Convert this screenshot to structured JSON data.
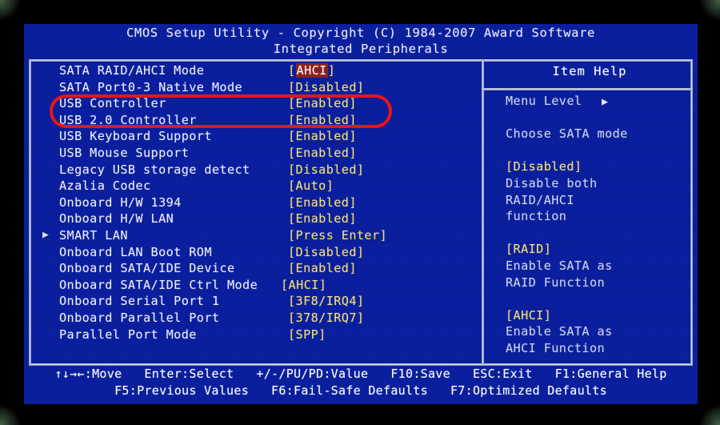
{
  "header": {
    "line1": "CMOS Setup Utility - Copyright (C) 1984-2007 Award Software",
    "line2": "Integrated Peripherals"
  },
  "settings": {
    "rows": [
      {
        "marker": "",
        "label": "SATA RAID/AHCI Mode",
        "value_prefix": "[",
        "value_hl": "AHCI",
        "value_suffix": "]",
        "highlighted": true
      },
      {
        "marker": "",
        "label": "SATA Port0-3 Native Mode",
        "value": "[Disabled]"
      },
      {
        "marker": "",
        "label": "USB Controller",
        "value": "[Enabled]"
      },
      {
        "marker": "",
        "label": "USB 2.0 Controller",
        "value": "[Enabled]"
      },
      {
        "marker": "",
        "label": "USB Keyboard Support",
        "value": "[Enabled]"
      },
      {
        "marker": "",
        "label": "USB Mouse Support",
        "value": "[Enabled]"
      },
      {
        "marker": "",
        "label": "Legacy USB storage detect",
        "value": "[Disabled]"
      },
      {
        "marker": "",
        "label": "Azalia Codec",
        "value": "[Auto]"
      },
      {
        "marker": "",
        "label": "Onboard H/W 1394",
        "value": "[Enabled]"
      },
      {
        "marker": "",
        "label": "Onboard H/W LAN",
        "value": "[Enabled]"
      },
      {
        "marker": "▶",
        "label": "SMART LAN",
        "value": "[Press Enter]"
      },
      {
        "marker": "",
        "label": "Onboard LAN Boot ROM",
        "value": "[Disabled]"
      },
      {
        "marker": "",
        "label": "Onboard SATA/IDE Device",
        "value": "[Enabled]"
      },
      {
        "marker": "",
        "label": "Onboard SATA/IDE Ctrl Mode",
        "value": "[AHCI]",
        "tight": true
      },
      {
        "marker": "",
        "label": "Onboard Serial Port 1",
        "value": "[3F8/IRQ4]"
      },
      {
        "marker": "",
        "label": "Onboard Parallel Port",
        "value": "[378/IRQ7]"
      },
      {
        "marker": "",
        "label": "Parallel Port Mode",
        "value": "[SPP]"
      }
    ]
  },
  "help": {
    "title": "Item Help",
    "menu_level_label": "Menu Level",
    "menu_level_arrow": "▶",
    "description": "Choose SATA mode",
    "options": [
      {
        "name": "[Disabled]",
        "lines": [
          "Disable both",
          "RAID/AHCI",
          "function"
        ]
      },
      {
        "name": "[RAID]",
        "lines": [
          "Enable SATA as",
          "RAID Function"
        ]
      },
      {
        "name": "[AHCI]",
        "lines": [
          "Enable SATA as",
          "AHCI Function"
        ]
      }
    ]
  },
  "footer": {
    "line1": "↑↓→←:Move   Enter:Select   +/-/PU/PD:Value   F10:Save   ESC:Exit   F1:General Help",
    "line2": "F5:Previous Values   F6:Fail-Safe Defaults   F7:Optimized Defaults"
  },
  "annotation": {
    "shape": "rounded-rectangle",
    "color": "#f01515",
    "targets": [
      "USB Controller",
      "USB 2.0 Controller"
    ]
  },
  "colors": {
    "screen_background": "#0a1fa0",
    "label_text": "#eef0f8",
    "value_text": "#f6e27a",
    "highlight_background": "#8d2222",
    "highlight_text": "#ffffff",
    "help_text": "#ced6ea",
    "border": "#dfe4f2",
    "frame": "#000000"
  }
}
